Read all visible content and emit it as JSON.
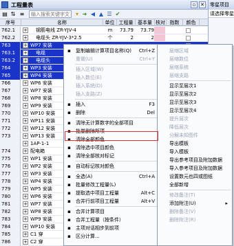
{
  "window": {
    "title": "工程量表"
  },
  "toolbar": {
    "search_placeholder": "输入搜索关键字文"
  },
  "columns": [
    "序号",
    "名称",
    "单位",
    "工程量",
    "基本量",
    "核对",
    "指数",
    "颜色"
  ],
  "rows": [
    {
      "seq": "762.1",
      "name": "钢筋电线 ZR-YJV-4",
      "unit": "m",
      "q1": "73.79",
      "q2": "73.79",
      "sel": false
    },
    {
      "seq": "762.2",
      "name": "电缆头 ZR-YJV-3*2.5",
      "unit": "个",
      "q1": "2",
      "q2": "2",
      "sel": false
    },
    {
      "seq": "763",
      "name": "WP7 安装",
      "unit": "",
      "q1": "",
      "q2": "",
      "sel": true
    },
    {
      "seq": "763.1",
      "name": "电缆",
      "unit": "",
      "q1": "",
      "q2": "",
      "sel": true
    },
    {
      "seq": "763.2",
      "name": "电缆头",
      "unit": "",
      "q1": "",
      "q2": "",
      "sel": true
    },
    {
      "seq": "764",
      "name": "WP3 安装",
      "unit": "",
      "q1": "",
      "q2": "",
      "sel": true
    },
    {
      "seq": "765",
      "name": "WP4 安装",
      "unit": "",
      "q1": "",
      "q2": "",
      "sel": true
    },
    {
      "seq": "766",
      "name": "WP6 安装",
      "unit": "",
      "q1": "",
      "q2": "",
      "sel": false
    },
    {
      "seq": "767",
      "name": "WP7 安装",
      "unit": "",
      "q1": "",
      "q2": "",
      "sel": false
    },
    {
      "seq": "768",
      "name": "WP8 安装",
      "unit": "",
      "q1": "",
      "q2": "",
      "sel": false
    },
    {
      "seq": "769",
      "name": "WP9 安装",
      "unit": "",
      "q1": "",
      "q2": "",
      "sel": false
    },
    {
      "seq": "770",
      "name": "WP10 安装",
      "unit": "",
      "q1": "",
      "q2": "",
      "sel": false
    },
    {
      "seq": "771",
      "name": "WP11 安装",
      "unit": "",
      "q1": "",
      "q2": "",
      "sel": false
    },
    {
      "seq": "772",
      "name": "WP12 安装",
      "unit": "",
      "q1": "",
      "q2": "",
      "sel": false
    },
    {
      "seq": "773",
      "name": "WP13 安装",
      "unit": "",
      "q1": "",
      "q2": "",
      "sel": false
    },
    {
      "seq": "",
      "name": "1AP-1-1",
      "unit": "",
      "q1": "",
      "q2": "",
      "sel": false
    },
    {
      "seq": "774",
      "name": "配电箱",
      "unit": "",
      "q1": "",
      "q2": "",
      "sel": false
    },
    {
      "seq": "775",
      "name": "WP1 安装",
      "unit": "",
      "q1": "",
      "q2": "",
      "sel": false
    },
    {
      "seq": "776",
      "name": "WP2 安装",
      "unit": "",
      "q1": "",
      "q2": "",
      "sel": false
    },
    {
      "seq": "777",
      "name": "WP3 安装",
      "unit": "",
      "q1": "",
      "q2": "",
      "sel": false
    },
    {
      "seq": "778",
      "name": "WP4 安装",
      "unit": "",
      "q1": "",
      "q2": "",
      "sel": false
    },
    {
      "seq": "779",
      "name": "WP5 安装",
      "unit": "",
      "q1": "",
      "q2": "",
      "sel": false
    },
    {
      "seq": "780",
      "name": "WP6 安装",
      "unit": "",
      "q1": "",
      "q2": "",
      "sel": false
    },
    {
      "seq": "781",
      "name": "WP7 安装",
      "unit": "",
      "q1": "",
      "q2": "",
      "sel": false
    },
    {
      "seq": "782",
      "name": "WP8 安装",
      "unit": "",
      "q1": "",
      "q2": "",
      "sel": false
    },
    {
      "seq": "783",
      "name": "WP9 安装",
      "unit": "",
      "q1": "",
      "q2": "",
      "sel": false
    },
    {
      "seq": "784",
      "name": "WP10 安装",
      "unit": "",
      "q1": "",
      "q2": "",
      "sel": false
    },
    {
      "seq": "785",
      "name": "C1 穿",
      "unit": "",
      "q1": "",
      "q2": "",
      "sel": false
    },
    {
      "seq": "786",
      "name": "C2 穿",
      "unit": "",
      "q1": "",
      "q2": "",
      "sel": false
    },
    {
      "seq": "",
      "name": "1AP-2",
      "unit": "",
      "q1": "",
      "q2": "",
      "sel": false
    }
  ],
  "right_panel": {
    "title": "零星项目",
    "subtitle": "请选择零星"
  },
  "context_menu_left": {
    "items": [
      {
        "label": "复制编辑计算项目名称(Q)",
        "shortcut": "Ctrl+Z",
        "disabled": false
      },
      {
        "label": "重做(U)",
        "shortcut": "Ctrl+Y",
        "disabled": true
      },
      {
        "sep": true
      },
      {
        "label": "插入区域(W)",
        "shortcut": "",
        "disabled": true
      },
      {
        "label": "插入数位(E)",
        "shortcut": "",
        "disabled": true
      },
      {
        "label": "插入系统(D)",
        "shortcut": "",
        "disabled": true
      },
      {
        "label": "插入支路(Z)",
        "shortcut": "",
        "disabled": true
      },
      {
        "sep": true
      },
      {
        "label": "插入",
        "shortcut": "F3",
        "disabled": false
      },
      {
        "label": "删除",
        "shortcut": "Del",
        "disabled": false
      },
      {
        "sep": true
      },
      {
        "label": "清除无计算数字的全部项目",
        "shortcut": "",
        "disabled": false
      },
      {
        "label": "批量删除所项",
        "shortcut": "",
        "disabled": false
      },
      {
        "label": "清除全部颜色",
        "shortcut": "",
        "disabled": false
      },
      {
        "label": "清除选中项目颜色",
        "shortcut": "",
        "disabled": false
      },
      {
        "label": "清除全部核对标记",
        "shortcut": "",
        "disabled": false
      },
      {
        "sep": true
      },
      {
        "label": "自动标记核对颜色",
        "shortcut": "",
        "disabled": false
      },
      {
        "sep": true
      },
      {
        "label": "全选(A)",
        "shortcut": "Ctrl+A",
        "disabled": false
      },
      {
        "label": "批量修改工程量(L)",
        "shortcut": "",
        "disabled": false
      },
      {
        "label": "提取选中项目工程量",
        "shortcut": "Alt+C",
        "disabled": false
      },
      {
        "label": "合并行前项目工程量",
        "shortcut": "Alt+V",
        "disabled": false
      },
      {
        "sep": true
      },
      {
        "label": "合并计算项目",
        "shortcut": "",
        "disabled": false
      },
      {
        "label": "合并工程量（按条件）",
        "shortcut": "",
        "disabled": false
      },
      {
        "label": "主项对话相步到前项",
        "shortcut": "",
        "disabled": false
      },
      {
        "label": "区分计算...",
        "shortcut": "",
        "disabled": false
      }
    ]
  },
  "context_menu_right": {
    "items": [
      {
        "label": "层缩区域",
        "disabled": true
      },
      {
        "label": "层缩数位",
        "disabled": true
      },
      {
        "label": "层缩系统",
        "disabled": true
      },
      {
        "label": "层缩支路",
        "disabled": true
      },
      {
        "sep": true
      },
      {
        "label": "显示至层次1",
        "disabled": false
      },
      {
        "label": "显示至层次2",
        "disabled": false
      },
      {
        "label": "显示至层次3",
        "disabled": false
      },
      {
        "label": "显示至层次4",
        "disabled": false
      },
      {
        "label": "提升层次",
        "disabled": true
      },
      {
        "label": "降低层次",
        "disabled": true
      },
      {
        "label": "分解未知图件",
        "disabled": true
      },
      {
        "label": "导出模板",
        "disabled": false
      },
      {
        "label": "导入模板",
        "disabled": false
      },
      {
        "label": "导出参考项目及附加数据",
        "disabled": false
      },
      {
        "label": "导入参考项目及附加数据",
        "disabled": false
      },
      {
        "label": "设置数元也四或图纸",
        "disabled": false
      },
      {
        "label": "全部新增",
        "disabled": false
      },
      {
        "sep": true
      },
      {
        "label": "修改备注(T)",
        "disabled": true
      },
      {
        "label": "添加附注(U)",
        "disabled": false,
        "arrow": true
      },
      {
        "label": "删除备注(V)",
        "disabled": true
      },
      {
        "label": "删除附注(R)",
        "disabled": true
      }
    ]
  }
}
